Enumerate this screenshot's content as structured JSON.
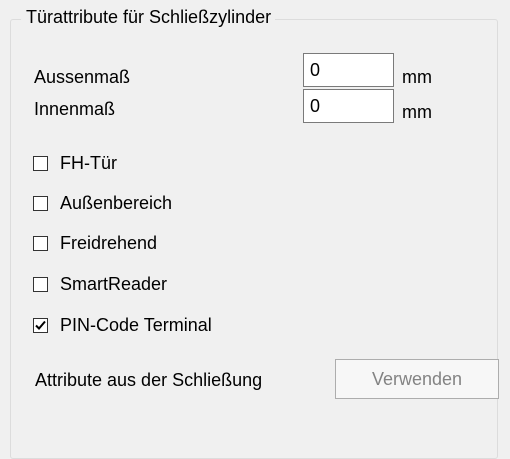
{
  "group": {
    "title": "Türattribute für Schließzylinder"
  },
  "fields": {
    "outer": {
      "label": "Aussenmaß",
      "value": "0",
      "unit": "mm"
    },
    "inner": {
      "label": "Innenmaß",
      "value": "0",
      "unit": "mm"
    }
  },
  "checkboxes": [
    {
      "label": "FH-Tür",
      "checked": false
    },
    {
      "label": "Außenbereich",
      "checked": false
    },
    {
      "label": "Freidrehend",
      "checked": false
    },
    {
      "label": "SmartReader",
      "checked": false
    },
    {
      "label": "PIN-Code Terminal",
      "checked": true
    }
  ],
  "attributes": {
    "label": "Attribute aus der Schließung",
    "button_label": "Verwenden",
    "button_enabled": false
  }
}
